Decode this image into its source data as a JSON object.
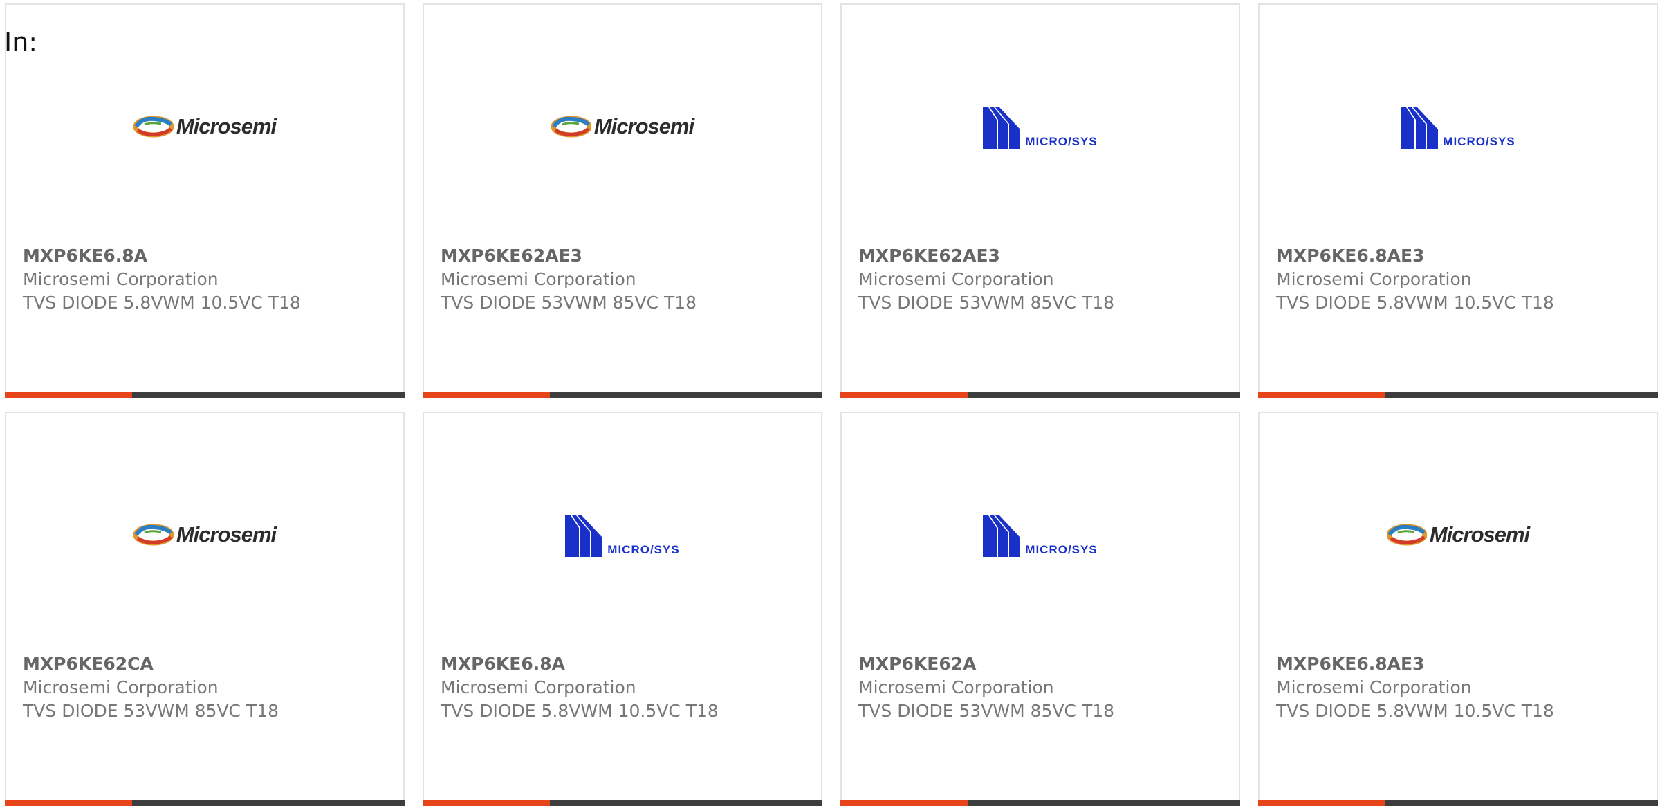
{
  "header": {
    "label": "In:"
  },
  "colors": {
    "accent": "#e8441a",
    "bar": "#3d3d3d",
    "microsys_blue": "#1a31c9"
  },
  "cards": [
    {
      "logo": "microsemi-logo",
      "logo_text": "Microsemi",
      "part": "MXP6KE6.8A",
      "manufacturer": "Microsemi Corporation",
      "description": "TVS DIODE 5.8VWM 10.5VC T18"
    },
    {
      "logo": "microsemi-logo",
      "logo_text": "Microsemi",
      "part": "MXP6KE62AE3",
      "manufacturer": "Microsemi Corporation",
      "description": "TVS DIODE 53VWM 85VC T18"
    },
    {
      "logo": "microsys-logo",
      "logo_text": "MICRO/SYS",
      "part": "MXP6KE62AE3",
      "manufacturer": "Microsemi Corporation",
      "description": "TVS DIODE 53VWM 85VC T18"
    },
    {
      "logo": "microsys-logo",
      "logo_text": "MICRO/SYS",
      "part": "MXP6KE6.8AE3",
      "manufacturer": "Microsemi Corporation",
      "description": "TVS DIODE 5.8VWM 10.5VC T18"
    },
    {
      "logo": "microsemi-logo",
      "logo_text": "Microsemi",
      "part": "MXP6KE62CA",
      "manufacturer": "Microsemi Corporation",
      "description": "TVS DIODE 53VWM 85VC T18"
    },
    {
      "logo": "microsys-logo",
      "logo_text": "MICRO/SYS",
      "part": "MXP6KE6.8A",
      "manufacturer": "Microsemi Corporation",
      "description": "TVS DIODE 5.8VWM 10.5VC T18"
    },
    {
      "logo": "microsys-logo",
      "logo_text": "MICRO/SYS",
      "part": "MXP6KE62A",
      "manufacturer": "Microsemi Corporation",
      "description": "TVS DIODE 53VWM 85VC T18"
    },
    {
      "logo": "microsemi-logo",
      "logo_text": "Microsemi",
      "part": "MXP6KE6.8AE3",
      "manufacturer": "Microsemi Corporation",
      "description": "TVS DIODE 5.8VWM 10.5VC T18"
    }
  ]
}
